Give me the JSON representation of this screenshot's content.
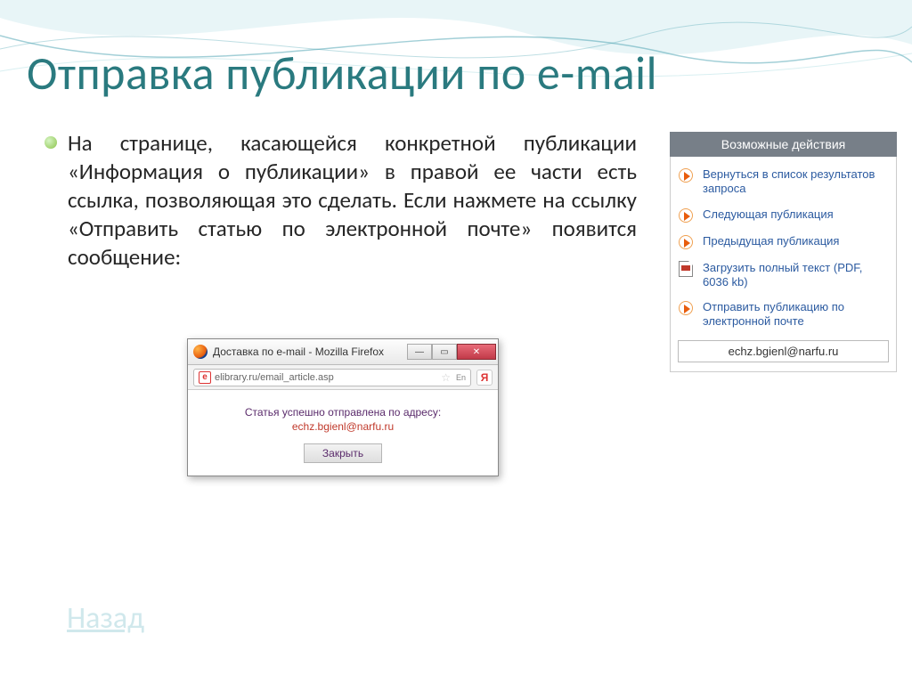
{
  "title": "Отправка публикации по e-mail",
  "paragraph": "На странице, касающейся конкретной публикации «Информация о публикации» в правой ее части есть ссылка, позволяющая это сделать. Если нажмете на ссылку «Отправить статью по электронной почте» появится сообщение:",
  "popup": {
    "window_title": "Доставка по e-mail - Mozilla Firefox",
    "url": "elibrary.ru/email_article.asp",
    "lang_badge": "En",
    "sent_text": "Статья успешно отправлена по адресу:",
    "email": "echz.bgienl@narfu.ru",
    "close_label": "Закрыть"
  },
  "sidebar": {
    "header": "Возможные действия",
    "items": [
      {
        "label": "Вернуться в список результатов запроса"
      },
      {
        "label": "Следующая публикация"
      },
      {
        "label": "Предыдущая публикация"
      },
      {
        "label": "Загрузить полный текст (PDF, 6036 kb)"
      },
      {
        "label": "Отправить публикацию по электронной почте"
      }
    ],
    "email_box": "echz.bgienl@narfu.ru"
  },
  "back_label": "Назад"
}
